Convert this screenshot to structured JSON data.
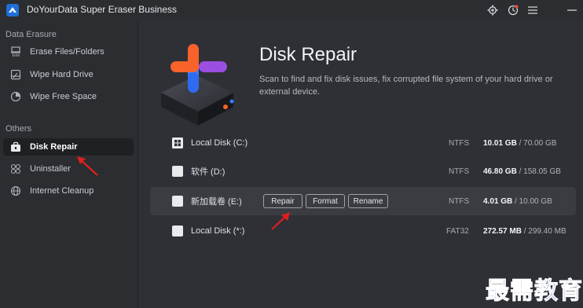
{
  "app": {
    "title": "DoYourData Super Eraser Business",
    "icons": [
      "settings-icon",
      "history-icon",
      "menu-icon",
      "minimize-icon"
    ]
  },
  "sidebar": {
    "sections": [
      {
        "title": "Data Erasure",
        "items": [
          {
            "label": "Erase Files/Folders",
            "icon": "file-shred-icon"
          },
          {
            "label": "Wipe Hard Drive",
            "icon": "hard-drive-icon"
          },
          {
            "label": "Wipe Free Space",
            "icon": "pie-icon"
          }
        ]
      },
      {
        "title": "Others",
        "items": [
          {
            "label": "Disk Repair",
            "icon": "toolbox-icon",
            "active": true
          },
          {
            "label": "Uninstaller",
            "icon": "apps-grid-icon"
          },
          {
            "label": "Internet Cleanup",
            "icon": "globe-icon"
          }
        ]
      }
    ]
  },
  "main": {
    "title": "Disk Repair",
    "description": "Scan to find and fix disk issues, fix corrupted file system of your hard drive or external device.",
    "disks": [
      {
        "name": "Local Disk (C:)",
        "fs": "NTFS",
        "used": "10.01 GB",
        "total": "/ 70.00 GB",
        "icon": "windows-icon"
      },
      {
        "name": "软件 (D:)",
        "fs": "NTFS",
        "used": "46.80 GB",
        "total": "/ 158.05 GB",
        "icon": "disk-icon"
      },
      {
        "name": "新加载卷 (E:)",
        "fs": "NTFS",
        "used": "4.01 GB",
        "total": "/ 10.00 GB",
        "icon": "disk-icon",
        "hovered": true
      },
      {
        "name": "Local Disk (*:)",
        "fs": "FAT32",
        "used": "272.57 MB",
        "total": "/ 299.40 MB",
        "icon": "disk-icon"
      }
    ],
    "row_actions": {
      "repair": "Repair",
      "format": "Format",
      "rename": "Rename"
    }
  },
  "watermark": "最需教育",
  "colors": {
    "accent_red": "#e0201e",
    "hero_orange": "#f7632a",
    "hero_blue": "#3a7bff",
    "watermark_blue": "#1d33c9"
  }
}
